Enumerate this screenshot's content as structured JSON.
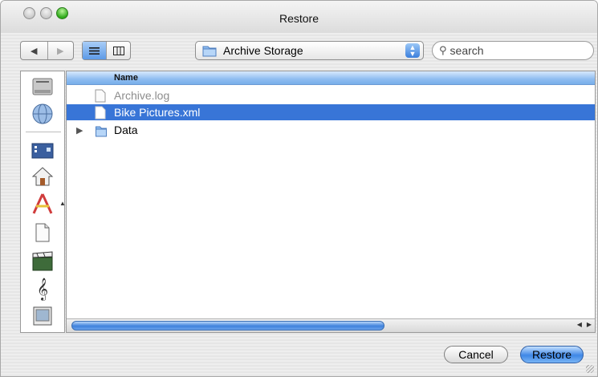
{
  "window": {
    "title": "Restore"
  },
  "toolbar": {
    "back_icon": "◀",
    "forward_icon": "▶",
    "location": "Archive Storage",
    "search_placeholder": "search"
  },
  "filelist": {
    "column_header": "Name",
    "rows": [
      {
        "name": "Archive.log",
        "type": "file",
        "state": "dimmed"
      },
      {
        "name": "Bike Pictures.xml",
        "type": "file",
        "state": "selected"
      },
      {
        "name": "Data",
        "type": "folder",
        "state": "collapsed"
      }
    ]
  },
  "sidebar": {
    "items": [
      "hard-disk-icon",
      "network-icon",
      "desktop-icon",
      "home-icon",
      "applications-icon",
      "documents-icon",
      "movies-icon",
      "music-icon",
      "pictures-icon"
    ]
  },
  "buttons": {
    "cancel": "Cancel",
    "restore": "Restore"
  },
  "colors": {
    "selection": "#3875d7",
    "accent": "#3f87e6"
  }
}
